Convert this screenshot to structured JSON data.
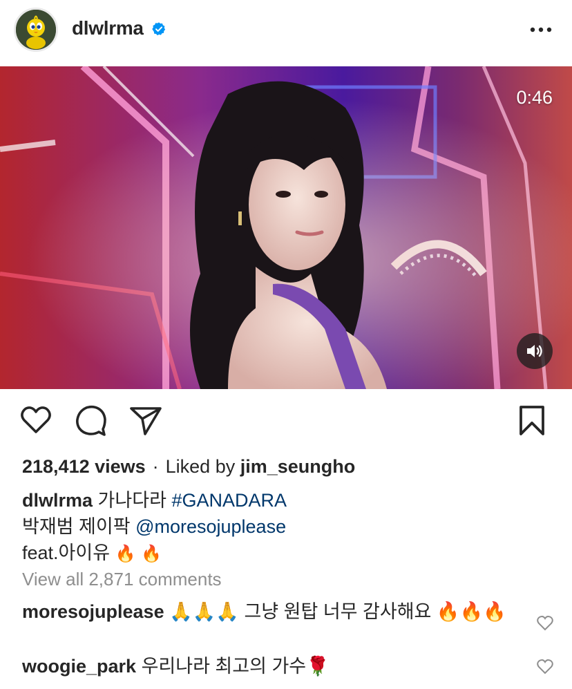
{
  "header": {
    "username": "dlwlrma",
    "avatar_icon": "tweety-bird-icon",
    "verified_icon": "verified-badge-icon",
    "more_icon": "more-horizontal-icon"
  },
  "media": {
    "duration": "0:46",
    "sound_icon": "speaker-icon"
  },
  "actions": {
    "like_icon": "heart-outline-icon",
    "comment_icon": "comment-bubble-icon",
    "share_icon": "paper-plane-icon",
    "save_icon": "bookmark-icon"
  },
  "stats": {
    "views": "218,412 views",
    "separator": "·",
    "liked_by_prefix": "Liked by",
    "liked_by_user": "jim_seungho"
  },
  "caption": {
    "username": "dlwlrma",
    "title": "가나다라",
    "hashtag": "#GANADARA",
    "line2_text": "박재범 제이팍",
    "mention": "@moresojuplease",
    "line3_text": "feat.아이유",
    "line3_emoji": "🔥 🔥"
  },
  "comments_link": "View all 2,871 comments",
  "comments": [
    {
      "username": "moresojuplease",
      "text": "🙏🙏🙏 그냥 원탑 너무 감사해요 🔥🔥🔥"
    },
    {
      "username": "woogie_park",
      "text": "우리나라 최고의 가수🌹"
    }
  ],
  "colors": {
    "text": "#262626",
    "link": "#00376b",
    "muted": "#8e8e8e",
    "verified": "#0095f6"
  }
}
